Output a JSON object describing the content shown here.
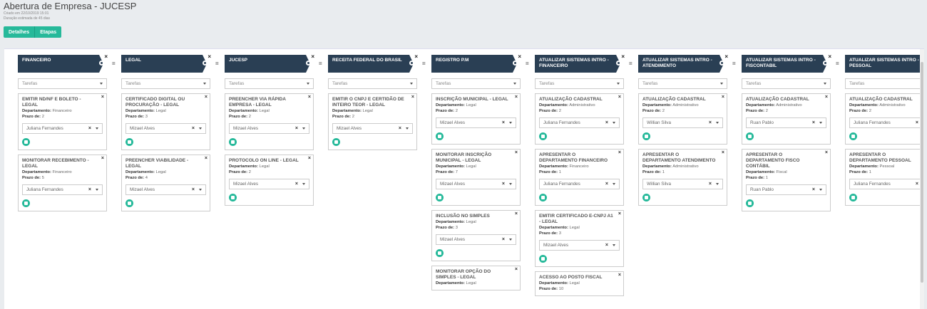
{
  "page": {
    "title": "Abertura de Empresa - JUCESP",
    "created": "Criado em 22/10/2019 15:01",
    "duration": "Duração estimada de 45 dias"
  },
  "tabs": [
    {
      "label": "Detalhes"
    },
    {
      "label": "Etapas"
    }
  ],
  "labels": {
    "tasks_placeholder": "Tarefas",
    "department": "Departamento:",
    "deadline": "Prazo de:"
  },
  "stages": [
    {
      "title": "FINANCEIRO",
      "cards": [
        {
          "title": "EMITIR ND/NF E BOLETO - LEGAL",
          "department": "Financeiro",
          "deadline": "2",
          "assignee": "Juliana Fernandes"
        },
        {
          "title": "MONITORAR RECEBIMENTO - LEGAL",
          "department": "Financeiro",
          "deadline": "5",
          "assignee": "Juliana Fernandes"
        }
      ]
    },
    {
      "title": "LEGAL",
      "cards": [
        {
          "title": "CERTIFICADO DIGITAL OU PROCURAÇÃO - LEGAL",
          "department": "Legal",
          "deadline": "3",
          "assignee": "Mizael Alves"
        },
        {
          "title": "PREENCHER VIABILIDADE - LEGAL",
          "department": "Legal",
          "deadline": "4",
          "assignee": "Mizael Alves"
        }
      ]
    },
    {
      "title": "JUCESP",
      "cards": [
        {
          "title": "PREENCHER VIA RÁPIDA EMPRESA - LEGAL",
          "department": "Legal",
          "deadline": "2",
          "assignee": "Mizael Alves"
        },
        {
          "title": "PROTOCOLO ON LINE - LEGAL",
          "department": "Legal",
          "deadline": "2",
          "assignee": "Mizael Alves"
        }
      ]
    },
    {
      "title": "RECEITA FEDERAL DO BRASIL",
      "cards": [
        {
          "title": "EMITIR O CNPJ E CERTIDÃO DE INTEIRO TEOR - LEGAL",
          "department": "Legal",
          "deadline": "2",
          "assignee": "Mizael Alves"
        }
      ]
    },
    {
      "title": "REGISTRO P.M",
      "cards": [
        {
          "title": "INSCRIÇÃO MUNICIPAL - LEGAL",
          "department": "Legal",
          "deadline": "2",
          "assignee": "Mizael Alves"
        },
        {
          "title": "MONITORAR INSCRIÇÃO MUNICIPAL - LEGAL",
          "department": "Legal",
          "deadline": "7",
          "assignee": "Mizael Alves"
        },
        {
          "title": "INCLUSÃO NO SIMPLES",
          "department": "Legal",
          "deadline": "3",
          "assignee": "Mizael Alves"
        },
        {
          "title": "MONITORAR OPÇÃO DO SIMPLES - LEGAL",
          "department": "Legal",
          "deadline": "",
          "assignee": ""
        }
      ]
    },
    {
      "title": "ATUALIZAR SISTEMAS INTRO - FINANCEIRO",
      "cards": [
        {
          "title": "ATUALIZAÇÃO CADASTRAL",
          "department": "Administrativo",
          "deadline": "2",
          "assignee": "Juliana Fernandes"
        },
        {
          "title": "APRESENTAR O DEPARTAMENTO FINANCEIRO",
          "department": "Financeiro",
          "deadline": "1",
          "assignee": "Juliana Fernandes"
        },
        {
          "title": "EMITIR CERTIFICADO E-CNPJ A1 - LEGAL",
          "department": "Legal",
          "deadline": "3",
          "assignee": "Mizael Alves"
        },
        {
          "title": "ACESSO AO POSTO FISCAL",
          "department": "Legal",
          "deadline": "10",
          "assignee": ""
        }
      ]
    },
    {
      "title": "ATUALIZAR SISTEMAS INTRO - ATENDIMENTO",
      "cards": [
        {
          "title": "ATUALIZAÇÃO CADASTRAL",
          "department": "Administrativo",
          "deadline": "2",
          "assignee": "Willian Silva"
        },
        {
          "title": "APRESENTAR O DEPARTAMENTO ATENDIMENTO",
          "department": "Administrativo",
          "deadline": "1",
          "assignee": "Willian Silva"
        }
      ]
    },
    {
      "title": "ATUALIZAR SISTEMAS INTRO - FISCONTABIL",
      "cards": [
        {
          "title": "ATUALIZAÇÃO CADASTRAL",
          "department": "Administrativo",
          "deadline": "2",
          "assignee": "Ruan Pablo"
        },
        {
          "title": "APRESENTAR O DEPARTAMENTO FISCO CONTÁBIL",
          "department": "Fiscal",
          "deadline": "1",
          "assignee": "Ruan Pablo"
        }
      ]
    },
    {
      "title": "ATUALIZAR SISTEMAS INTRO - PESSOAL",
      "cards": [
        {
          "title": "ATUALIZAÇÃO CADASTRAL",
          "department": "Administrativo",
          "deadline": "2",
          "assignee": "Juliana Fernandes"
        },
        {
          "title": "APRESENTAR O DEPARTAMENTO PESSOAL",
          "department": "Pessoal",
          "deadline": "1",
          "assignee": "Juliana Fernandes"
        }
      ]
    }
  ]
}
